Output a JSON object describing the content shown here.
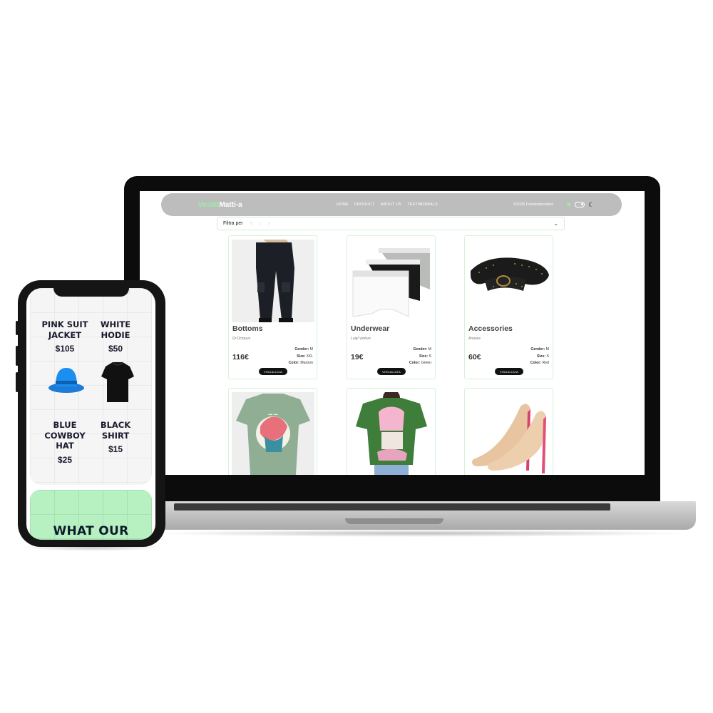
{
  "laptop": {
    "nav": {
      "brand_part1": "Vestiti",
      "brand_part2": "Matti-a",
      "links": [
        "HOME",
        "PRODUCT",
        "ABOUT US",
        "TESTIMONIALS"
      ],
      "copyright": "©2025 Fashionproduct",
      "icons": [
        "sun-icon",
        "toggle-switch",
        "moon-icon"
      ]
    },
    "filter": {
      "label": "Filtra per"
    },
    "products": [
      {
        "title": "Bottoms",
        "brand": "Dr.Octopus",
        "price": "116€",
        "gender": "M",
        "size": "3XL",
        "color": "Maroon",
        "button": "VISUALIZZA"
      },
      {
        "title": "Underwear",
        "brand": "Luigi Vettore",
        "price": "19€",
        "gender": "M",
        "size": "S",
        "color": "Green",
        "button": "VISUALIZZA"
      },
      {
        "title": "Accessories",
        "brand": "Ananas",
        "price": "60€",
        "gender": "M",
        "size": "S",
        "color": "Red",
        "button": "VISUALIZZA"
      }
    ],
    "spec_labels": {
      "gender": "Gender:",
      "size": "Size:",
      "color": "Color:"
    }
  },
  "phone": {
    "items": [
      {
        "name": "PINK SUIT JACKET",
        "price": "$105"
      },
      {
        "name": "WHITE HODIE",
        "price": "$50"
      },
      {
        "name": "BLUE COWBOY HAT",
        "price": "$25"
      },
      {
        "name": "BLACK SHIRT",
        "price": "$15"
      }
    ],
    "hero_text": "WHAT OUR"
  },
  "colors": {
    "brand_green": "#9fe8a8",
    "hero_green": "#b7f1c2",
    "navbar_gray": "#bdbdbd"
  }
}
